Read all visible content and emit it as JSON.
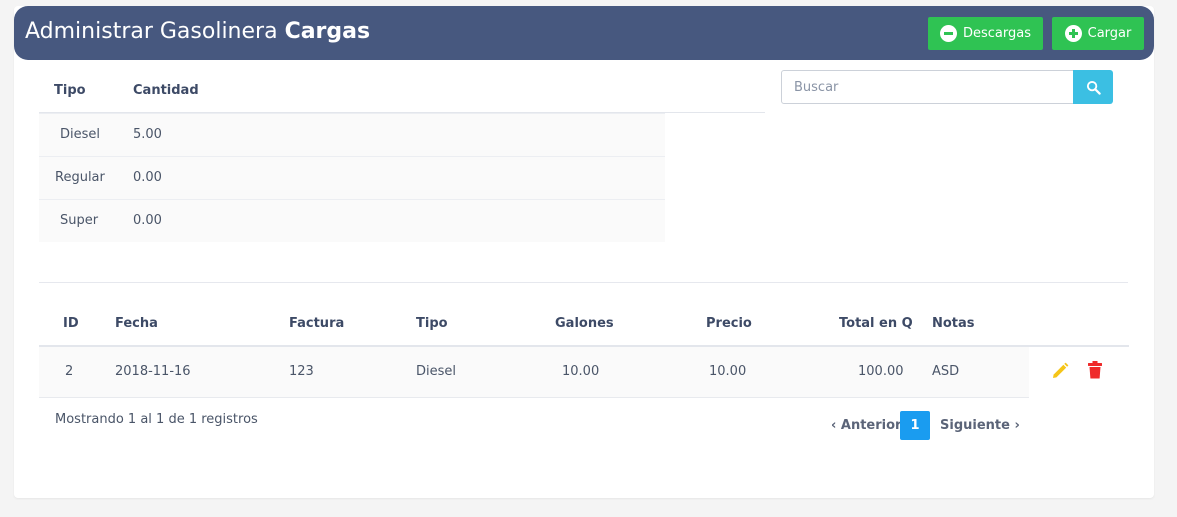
{
  "header": {
    "title_prefix": "Administrar Gasolinera",
    "title_bold": "Cargas",
    "descargas_label": "Descargas",
    "cargar_label": "Cargar"
  },
  "summary": {
    "headers": [
      "Tipo",
      "Cantidad"
    ],
    "rows": [
      {
        "tipo": "Diesel",
        "cantidad": "5.00"
      },
      {
        "tipo": "Regular",
        "cantidad": "0.00"
      },
      {
        "tipo": "Super",
        "cantidad": "0.00"
      }
    ]
  },
  "search": {
    "placeholder": "Buscar",
    "value": ""
  },
  "table": {
    "headers": [
      "ID",
      "Fecha",
      "Factura",
      "Tipo",
      "Galones",
      "Precio",
      "Total en Q",
      "Notas"
    ],
    "rows": [
      {
        "id": "2",
        "fecha": "2018-11-16",
        "factura": "123",
        "tipo": "Diesel",
        "galones": "10.00",
        "precio": "10.00",
        "total": "100.00",
        "notas": "ASD"
      }
    ]
  },
  "footer": {
    "info": "Mostrando 1 al 1 de 1 registros",
    "prev": "‹ Anterior",
    "page": "1",
    "next": "Siguiente ›"
  },
  "colors": {
    "header_bg": "#47587f",
    "button_green": "#2fc353",
    "search_blue": "#3bbfe3",
    "edit_yellow": "#f5c518",
    "delete_red": "#ef2b2b",
    "page_active": "#1a9cf0"
  },
  "icons": {
    "descargas": "minus-circle-icon",
    "cargar": "plus-circle-icon",
    "search": "search-icon",
    "edit": "pencil-icon",
    "delete": "trash-icon"
  }
}
